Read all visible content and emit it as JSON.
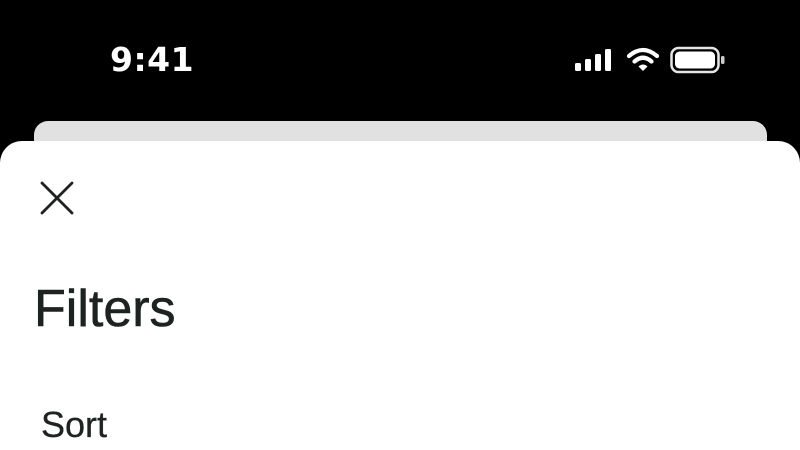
{
  "status_bar": {
    "time": "9:41",
    "icons": [
      "signal-icon",
      "wifi-icon",
      "battery-icon"
    ]
  },
  "filters_sheet": {
    "close_icon": "close-icon",
    "title": "Filters",
    "sections": [
      {
        "label": "Sort"
      }
    ]
  },
  "colors": {
    "background": "#000000",
    "sheet": "#ffffff",
    "back_card": "#e1e1e1",
    "text": "#1c2320"
  }
}
